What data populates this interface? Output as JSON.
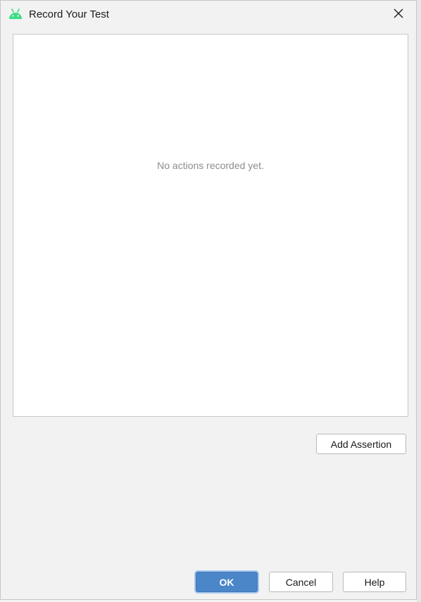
{
  "window": {
    "title": "Record Your Test",
    "app_icon": "android-icon",
    "close_icon": "close-icon"
  },
  "panel": {
    "empty_message": "No actions recorded yet."
  },
  "buttons": {
    "add_assertion": "Add Assertion",
    "ok": "OK",
    "cancel": "Cancel",
    "help": "Help"
  },
  "colors": {
    "android_green": "#3ddc84",
    "primary_button": "#4a86c8"
  }
}
